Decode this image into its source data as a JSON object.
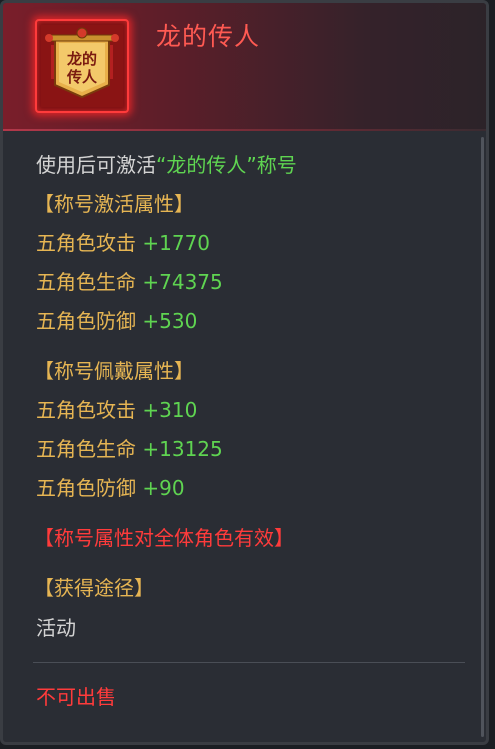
{
  "item": {
    "name": "龙的传人",
    "icon_text_line1": "龙的",
    "icon_text_line2": "传人"
  },
  "usage": {
    "prefix": "使用后可激活",
    "title_quoted": "“龙的传人”",
    "suffix": "称号"
  },
  "activation_section": {
    "header": "【称号激活属性】",
    "stats": [
      {
        "label": "五角色攻击",
        "value": "+1770"
      },
      {
        "label": "五角色生命",
        "value": "+74375"
      },
      {
        "label": "五角色防御",
        "value": "+530"
      }
    ]
  },
  "wear_section": {
    "header": "【称号佩戴属性】",
    "stats": [
      {
        "label": "五角色攻击",
        "value": "+310"
      },
      {
        "label": "五角色生命",
        "value": "+13125"
      },
      {
        "label": "五角色防御",
        "value": "+90"
      }
    ]
  },
  "notice": "【称号属性对全体角色有效】",
  "acquire": {
    "header": "【获得途径】",
    "source": "活动"
  },
  "sell_status": "不可出售",
  "colors": {
    "title": "#ff5a52",
    "gold": "#e6b553",
    "green": "#5fd451",
    "red": "#ff3b3b",
    "text": "#d4d4d4"
  }
}
